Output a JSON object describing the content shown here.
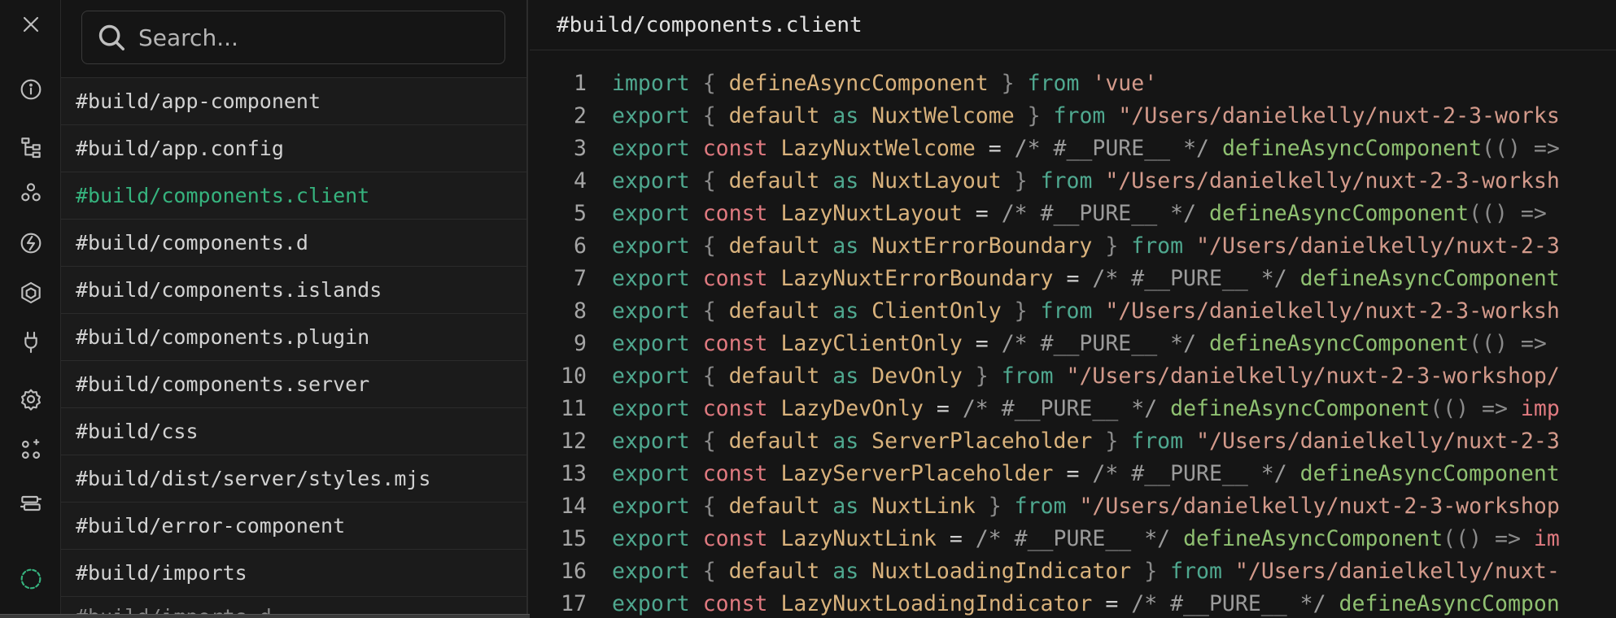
{
  "sidebar": {
    "icons": [
      {
        "name": "close-icon",
        "active": false
      },
      {
        "name": "info-icon",
        "active": false
      },
      {
        "name": "tree-icon",
        "active": false
      },
      {
        "name": "components-icon",
        "active": false
      },
      {
        "name": "imports-icon",
        "active": false
      },
      {
        "name": "modules-icon",
        "active": false
      },
      {
        "name": "plug-icon",
        "active": false
      },
      {
        "name": "gear-icon",
        "active": false
      },
      {
        "name": "nodes-icon",
        "active": false
      },
      {
        "name": "server-icon",
        "active": false
      },
      {
        "name": "virtual-files-icon",
        "active": true
      }
    ]
  },
  "search": {
    "placeholder": "Search..."
  },
  "files": [
    "#build/app-component",
    "#build/app.config",
    "#build/components.client",
    "#build/components.d",
    "#build/components.islands",
    "#build/components.plugin",
    "#build/components.server",
    "#build/css",
    "#build/dist/server/styles.mjs",
    "#build/error-component",
    "#build/imports",
    "#build/imports.d"
  ],
  "selected_file": "#build/components.client",
  "code": {
    "title": "#build/components.client",
    "lines": [
      [
        [
          "kw",
          "import"
        ],
        [
          "pn",
          " { "
        ],
        [
          "id",
          "defineAsyncComponent"
        ],
        [
          "pn",
          " } "
        ],
        [
          "kw",
          "from"
        ],
        [
          "pl",
          " "
        ],
        [
          "st",
          "'vue'"
        ]
      ],
      [
        [
          "kw",
          "export"
        ],
        [
          "pn",
          " { "
        ],
        [
          "id",
          "default"
        ],
        [
          "pl",
          " "
        ],
        [
          "kw",
          "as"
        ],
        [
          "pl",
          " "
        ],
        [
          "id",
          "NuxtWelcome"
        ],
        [
          "pn",
          " } "
        ],
        [
          "kw",
          "from"
        ],
        [
          "pl",
          " "
        ],
        [
          "st",
          "\"/Users/danielkelly/nuxt-2-3-works"
        ]
      ],
      [
        [
          "kw",
          "export"
        ],
        [
          "pl",
          " "
        ],
        [
          "kw2",
          "const"
        ],
        [
          "pl",
          " "
        ],
        [
          "id",
          "LazyNuxtWelcome"
        ],
        [
          "pl",
          " = "
        ],
        [
          "cm",
          "/* #__PURE__ */"
        ],
        [
          "pl",
          " "
        ],
        [
          "fn",
          "defineAsyncComponent"
        ],
        [
          "pn",
          "(() =>"
        ]
      ],
      [
        [
          "kw",
          "export"
        ],
        [
          "pn",
          " { "
        ],
        [
          "id",
          "default"
        ],
        [
          "pl",
          " "
        ],
        [
          "kw",
          "as"
        ],
        [
          "pl",
          " "
        ],
        [
          "id",
          "NuxtLayout"
        ],
        [
          "pn",
          " } "
        ],
        [
          "kw",
          "from"
        ],
        [
          "pl",
          " "
        ],
        [
          "st",
          "\"/Users/danielkelly/nuxt-2-3-worksh"
        ]
      ],
      [
        [
          "kw",
          "export"
        ],
        [
          "pl",
          " "
        ],
        [
          "kw2",
          "const"
        ],
        [
          "pl",
          " "
        ],
        [
          "id",
          "LazyNuxtLayout"
        ],
        [
          "pl",
          " = "
        ],
        [
          "cm",
          "/* #__PURE__ */"
        ],
        [
          "pl",
          " "
        ],
        [
          "fn",
          "defineAsyncComponent"
        ],
        [
          "pn",
          "(() =>"
        ]
      ],
      [
        [
          "kw",
          "export"
        ],
        [
          "pn",
          " { "
        ],
        [
          "id",
          "default"
        ],
        [
          "pl",
          " "
        ],
        [
          "kw",
          "as"
        ],
        [
          "pl",
          " "
        ],
        [
          "id",
          "NuxtErrorBoundary"
        ],
        [
          "pn",
          " } "
        ],
        [
          "kw",
          "from"
        ],
        [
          "pl",
          " "
        ],
        [
          "st",
          "\"/Users/danielkelly/nuxt-2-3"
        ]
      ],
      [
        [
          "kw",
          "export"
        ],
        [
          "pl",
          " "
        ],
        [
          "kw2",
          "const"
        ],
        [
          "pl",
          " "
        ],
        [
          "id",
          "LazyNuxtErrorBoundary"
        ],
        [
          "pl",
          " = "
        ],
        [
          "cm",
          "/* #__PURE__ */"
        ],
        [
          "pl",
          " "
        ],
        [
          "fn",
          "defineAsyncComponent"
        ]
      ],
      [
        [
          "kw",
          "export"
        ],
        [
          "pn",
          " { "
        ],
        [
          "id",
          "default"
        ],
        [
          "pl",
          " "
        ],
        [
          "kw",
          "as"
        ],
        [
          "pl",
          " "
        ],
        [
          "id",
          "ClientOnly"
        ],
        [
          "pn",
          " } "
        ],
        [
          "kw",
          "from"
        ],
        [
          "pl",
          " "
        ],
        [
          "st",
          "\"/Users/danielkelly/nuxt-2-3-worksh"
        ]
      ],
      [
        [
          "kw",
          "export"
        ],
        [
          "pl",
          " "
        ],
        [
          "kw2",
          "const"
        ],
        [
          "pl",
          " "
        ],
        [
          "id",
          "LazyClientOnly"
        ],
        [
          "pl",
          " = "
        ],
        [
          "cm",
          "/* #__PURE__ */"
        ],
        [
          "pl",
          " "
        ],
        [
          "fn",
          "defineAsyncComponent"
        ],
        [
          "pn",
          "(() =>"
        ]
      ],
      [
        [
          "kw",
          "export"
        ],
        [
          "pn",
          " { "
        ],
        [
          "id",
          "default"
        ],
        [
          "pl",
          " "
        ],
        [
          "kw",
          "as"
        ],
        [
          "pl",
          " "
        ],
        [
          "id",
          "DevOnly"
        ],
        [
          "pn",
          " } "
        ],
        [
          "kw",
          "from"
        ],
        [
          "pl",
          " "
        ],
        [
          "st",
          "\"/Users/danielkelly/nuxt-2-3-workshop/"
        ]
      ],
      [
        [
          "kw",
          "export"
        ],
        [
          "pl",
          " "
        ],
        [
          "kw2",
          "const"
        ],
        [
          "pl",
          " "
        ],
        [
          "id",
          "LazyDevOnly"
        ],
        [
          "pl",
          " = "
        ],
        [
          "cm",
          "/* #__PURE__ */"
        ],
        [
          "pl",
          " "
        ],
        [
          "fn",
          "defineAsyncComponent"
        ],
        [
          "pn",
          "(() => "
        ],
        [
          "kw2",
          "imp"
        ]
      ],
      [
        [
          "kw",
          "export"
        ],
        [
          "pn",
          " { "
        ],
        [
          "id",
          "default"
        ],
        [
          "pl",
          " "
        ],
        [
          "kw",
          "as"
        ],
        [
          "pl",
          " "
        ],
        [
          "id",
          "ServerPlaceholder"
        ],
        [
          "pn",
          " } "
        ],
        [
          "kw",
          "from"
        ],
        [
          "pl",
          " "
        ],
        [
          "st",
          "\"/Users/danielkelly/nuxt-2-3"
        ]
      ],
      [
        [
          "kw",
          "export"
        ],
        [
          "pl",
          " "
        ],
        [
          "kw2",
          "const"
        ],
        [
          "pl",
          " "
        ],
        [
          "id",
          "LazyServerPlaceholder"
        ],
        [
          "pl",
          " = "
        ],
        [
          "cm",
          "/* #__PURE__ */"
        ],
        [
          "pl",
          " "
        ],
        [
          "fn",
          "defineAsyncComponent"
        ]
      ],
      [
        [
          "kw",
          "export"
        ],
        [
          "pn",
          " { "
        ],
        [
          "id",
          "default"
        ],
        [
          "pl",
          " "
        ],
        [
          "kw",
          "as"
        ],
        [
          "pl",
          " "
        ],
        [
          "id",
          "NuxtLink"
        ],
        [
          "pn",
          " } "
        ],
        [
          "kw",
          "from"
        ],
        [
          "pl",
          " "
        ],
        [
          "st",
          "\"/Users/danielkelly/nuxt-2-3-workshop"
        ]
      ],
      [
        [
          "kw",
          "export"
        ],
        [
          "pl",
          " "
        ],
        [
          "kw2",
          "const"
        ],
        [
          "pl",
          " "
        ],
        [
          "id",
          "LazyNuxtLink"
        ],
        [
          "pl",
          " = "
        ],
        [
          "cm",
          "/* #__PURE__ */"
        ],
        [
          "pl",
          " "
        ],
        [
          "fn",
          "defineAsyncComponent"
        ],
        [
          "pn",
          "(() => "
        ],
        [
          "kw2",
          "im"
        ]
      ],
      [
        [
          "kw",
          "export"
        ],
        [
          "pn",
          " { "
        ],
        [
          "id",
          "default"
        ],
        [
          "pl",
          " "
        ],
        [
          "kw",
          "as"
        ],
        [
          "pl",
          " "
        ],
        [
          "id",
          "NuxtLoadingIndicator"
        ],
        [
          "pn",
          " } "
        ],
        [
          "kw",
          "from"
        ],
        [
          "pl",
          " "
        ],
        [
          "st",
          "\"/Users/danielkelly/nuxt-"
        ]
      ],
      [
        [
          "kw",
          "export"
        ],
        [
          "pl",
          " "
        ],
        [
          "kw2",
          "const"
        ],
        [
          "pl",
          " "
        ],
        [
          "id",
          "LazyNuxtLoadingIndicator"
        ],
        [
          "pl",
          " = "
        ],
        [
          "cm",
          "/* #__PURE__ */"
        ],
        [
          "pl",
          " "
        ],
        [
          "fn",
          "defineAsyncCompon"
        ]
      ]
    ]
  }
}
